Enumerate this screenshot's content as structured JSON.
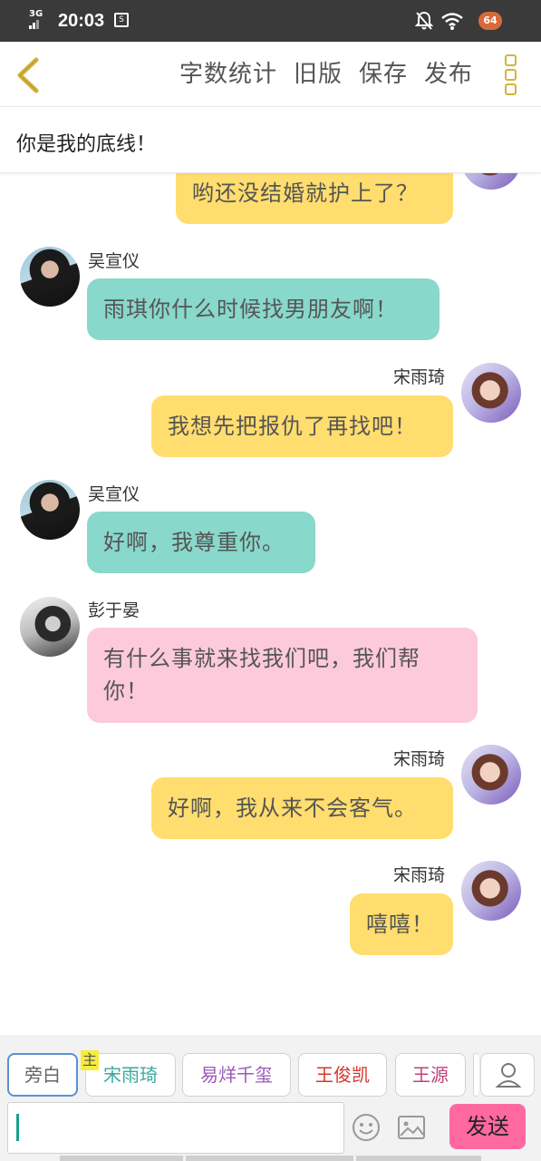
{
  "status_bar": {
    "network": "3G",
    "time": "20:03",
    "sim_icon_text": "S",
    "battery": "64"
  },
  "toolbar": {
    "word_count": "字数统计",
    "old_version": "旧版",
    "save": "保存",
    "publish": "发布"
  },
  "story": {
    "title": "你是我的底线！"
  },
  "messages": [
    {
      "speaker": "",
      "side": "right",
      "text": "哟还没结婚就护上了？",
      "color": "yellow"
    },
    {
      "speaker": "吴宣仪",
      "side": "left",
      "text": "雨琪你什么时候找男朋友啊！",
      "color": "teal"
    },
    {
      "speaker": "宋雨琦",
      "side": "right",
      "text": "我想先把报仇了再找吧！",
      "color": "yellow"
    },
    {
      "speaker": "吴宣仪",
      "side": "left",
      "text": "好啊，我尊重你。",
      "color": "teal"
    },
    {
      "speaker": "彭于晏",
      "side": "left",
      "text_line1": "有什么事就来找我们吧，我们帮",
      "text_line2": "你！",
      "color": "pink"
    },
    {
      "speaker": "宋雨琦",
      "side": "right",
      "text": "好啊，我从来不会客气。",
      "color": "yellow"
    },
    {
      "speaker": "宋雨琦",
      "side": "right",
      "text": "嘻嘻！",
      "color": "yellow"
    }
  ],
  "roles": {
    "narration": "旁白",
    "main_tag": "主",
    "items": [
      {
        "label": "宋雨琦",
        "color": "#3aa9a0"
      },
      {
        "label": "易烊千玺",
        "color": "#9b59b6"
      },
      {
        "label": "王俊凯",
        "color": "#d9342b"
      },
      {
        "label": "王源",
        "color": "#c2417a"
      }
    ]
  },
  "composer": {
    "input_value": "",
    "send": "发送"
  },
  "colors": {
    "yellow_bubble": "#ffdd6e",
    "teal_bubble": "#88d8cb",
    "pink_bubble": "#fdcadb",
    "send_button": "#ff69a0",
    "accent": "#d4b43b"
  }
}
